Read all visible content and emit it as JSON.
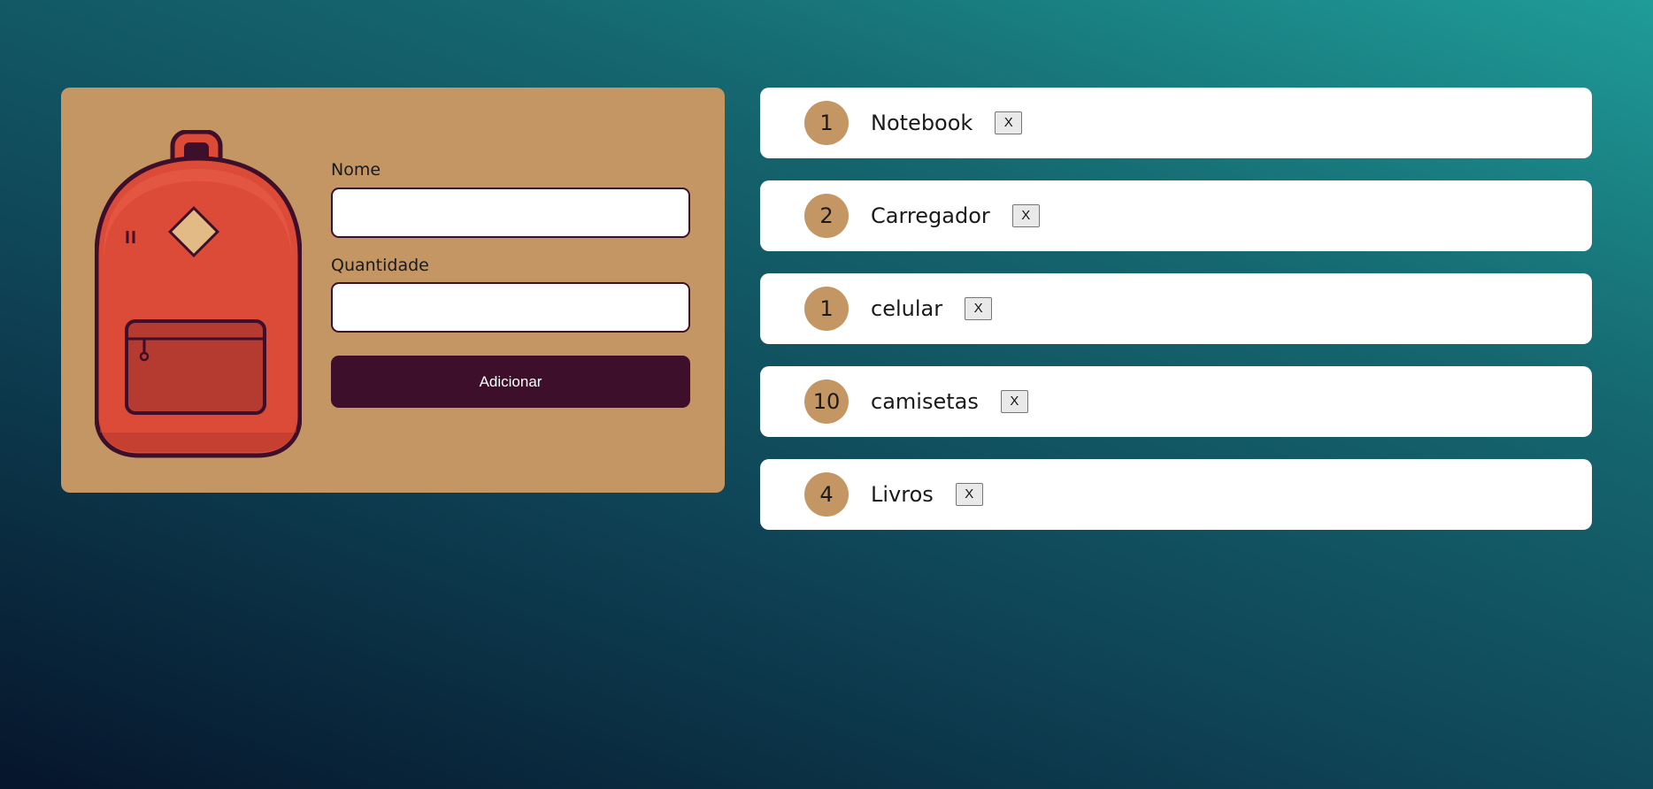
{
  "form": {
    "name_label": "Nome",
    "name_value": "",
    "quantity_label": "Quantidade",
    "quantity_value": "",
    "submit_label": "Adicionar"
  },
  "items": [
    {
      "quantity": "1",
      "name": "Notebook",
      "remove_label": "X"
    },
    {
      "quantity": "2",
      "name": "Carregador",
      "remove_label": "X"
    },
    {
      "quantity": "1",
      "name": "celular",
      "remove_label": "X"
    },
    {
      "quantity": "10",
      "name": "camisetas",
      "remove_label": "X"
    },
    {
      "quantity": "4",
      "name": "Livros",
      "remove_label": "X"
    }
  ],
  "colors": {
    "card": "#c49663",
    "button": "#3d0f2a",
    "backpack_body": "#dc4a38",
    "backpack_outline": "#3d0f2a",
    "badge": "#c49663"
  },
  "icons": {
    "illustration": "backpack-illustration"
  }
}
